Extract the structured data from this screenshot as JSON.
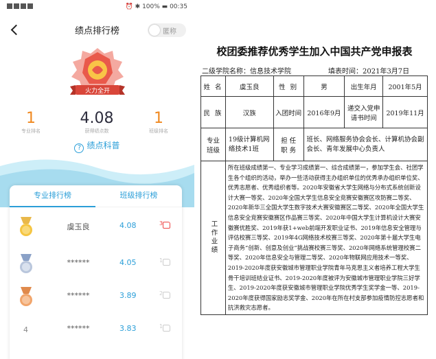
{
  "status_bar": {
    "left": "∷∶∵ ∴ ″",
    "time": "00:35",
    "battery": "100%"
  },
  "nav": {
    "title": "绩点排行榜",
    "anonymous_label": "匿称"
  },
  "badge": {
    "label": "火力全开",
    "colors": {
      "primary": "#e9594b",
      "accent": "#f9c447"
    }
  },
  "stats": {
    "major_rank": {
      "value": "1",
      "label": "专业排名"
    },
    "gpa": {
      "value": "4.08",
      "label": "获得绩点数"
    },
    "class_rank": {
      "value": "1",
      "label": "班级排名"
    }
  },
  "gpa_help": "绩点科普",
  "tabs": {
    "major": "专业排行榜",
    "class": "班级排行榜"
  },
  "ranking": [
    {
      "rank": "1",
      "medal": "gold",
      "name": "虞玉良",
      "score": "4.08",
      "likes": "3"
    },
    {
      "rank": "2",
      "medal": "silver",
      "name": "******",
      "score": "4.05",
      "likes": "1"
    },
    {
      "rank": "3",
      "medal": "bronze",
      "name": "******",
      "score": "3.89",
      "likes": "2"
    },
    {
      "rank": "4",
      "medal": "",
      "name": "******",
      "score": "3.83",
      "likes": "1"
    }
  ],
  "colors": {
    "accent_blue": "#2a9ed8",
    "orange": "#f0881f",
    "wave": "#a7dcef"
  },
  "document": {
    "title": "校团委推荐优秀学生加入中国共产党申报表",
    "college": "二级学院名称：信息技术学院",
    "date": "填表时间：2021年3月7日",
    "row1": {
      "name_label": "姓  名",
      "name": "虞玉良",
      "gender_label": "性 别",
      "gender": "男",
      "birth_label": "出生年月",
      "birth": "2001年5月"
    },
    "row2": {
      "ethnic_label": "民  族",
      "ethnic": "汉族",
      "league_label": "入团时间",
      "league": "2016年9月",
      "apply_label": "递交入党申请书时间",
      "apply": "2019年11月"
    },
    "row3": {
      "class_label": "专业班级",
      "class": "19级计算机网络技术1班",
      "duty_label": "担 任 职 务",
      "duty": "班长、网络服务协会会长、计算机协会副会长、青年发展中心负责人"
    },
    "performance_label": "工作业绩",
    "performance": "所在班级成绩第一、专业学习成绩第一、综合成绩第一，参加学生会、社团学生各个组织的活动，举办一些活动获得主办组织单位的优秀承办组织单位奖、优秀志愿者、优秀组织者等。2020年安徽省大学生网络与分布式系统创新设计大赛一等奖、2020年全国大学生信息安全竞赛安徽赛区攻防赛二等奖、2020年新华三全国大学生数字技术大赛安徽赛区二等奖、2020年全国大学生信息安全竞赛安徽赛区作品赛三等奖、2020年中国大学生计算机设计大赛安徽赛优胜奖、2019年获1+web前端开发职业证书、2019年信息安全管理与评估校赛三等奖、2019年4G网络技术校赛三等奖、2020年第十届大学生电子商务“创新、创意及创业”挑战赛校赛三等奖、2020年网络系统管理校赛二等奖、2020年信息安全与管理二等奖、2020年物联网应用技术一等奖、2019-2020年度获安徽城市管理职业学院青年马克思主义者培养工程大学生骨干培训班结业证书、2019-2020年度被评为安徽城市管理职业学院三好学生、2019-2020年度获安徽城市管理职业学院优秀学生奖学金一等、2019-2020年度获得国家励志奖学金、2020年在所在村支部参加疫情防控志愿者和抗洪救灾志愿者。"
  }
}
